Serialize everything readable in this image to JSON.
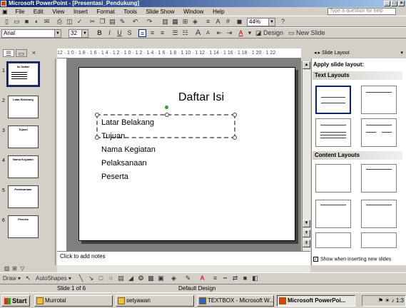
{
  "window": {
    "title": "Microsoft PowerPoint - [Presentasi_Pendukung]"
  },
  "menubar": {
    "items": [
      "File",
      "Edit",
      "View",
      "Insert",
      "Format",
      "Tools",
      "Slide Show",
      "Window",
      "Help"
    ],
    "ask_placeholder": "Type a question for help"
  },
  "standard_toolbar": {
    "zoom": "44%"
  },
  "format_toolbar": {
    "font": "Arial",
    "size": "32",
    "design_label": "Design",
    "new_slide_label": "New Slide"
  },
  "ruler": {
    "ticks": "12 · 1 0 · 1 8 · 1 6 · 1 4 · 1 2 · 1 0 · 1 2 · 1 4 · 1 6 · 1 8 · 1 10 · 1 12 · 1 14 · 1 16 · 1 18 · 1 20 · 1 22"
  },
  "slides": [
    {
      "num": "1",
      "title": "Isi Daftar"
    },
    {
      "num": "2",
      "title": "Latar Belakang"
    },
    {
      "num": "3",
      "title": "Tujuan"
    },
    {
      "num": "4",
      "title": "Nama Kegiatan"
    },
    {
      "num": "5",
      "title": "Pelaksanaan"
    },
    {
      "num": "6",
      "title": "Peserta"
    }
  ],
  "slide": {
    "title": "Daftar Isi",
    "bullets": [
      "Latar Belakang",
      "Tujuan",
      "Nama Kegiatan",
      "Pelaksanaan",
      "Peserta"
    ]
  },
  "notes": {
    "placeholder": "Click to add notes"
  },
  "taskpane": {
    "header": "Slide Layout",
    "apply_label": "Apply slide layout:",
    "text_layouts": "Text Layouts",
    "content_layouts": "Content Layouts",
    "show_label": "Show when inserting new slides"
  },
  "drawbar": {
    "draw": "Draw",
    "autoshapes": "AutoShapes"
  },
  "status": {
    "slide": "Slide 1 of 6",
    "design": "Default Design"
  },
  "taskbar": {
    "start": "Start",
    "tasks": [
      "Murrotal",
      "setyawan",
      "TEXTBOX - Microsoft W...",
      "Microsoft PowerPoi..."
    ],
    "clock": "1:3"
  }
}
